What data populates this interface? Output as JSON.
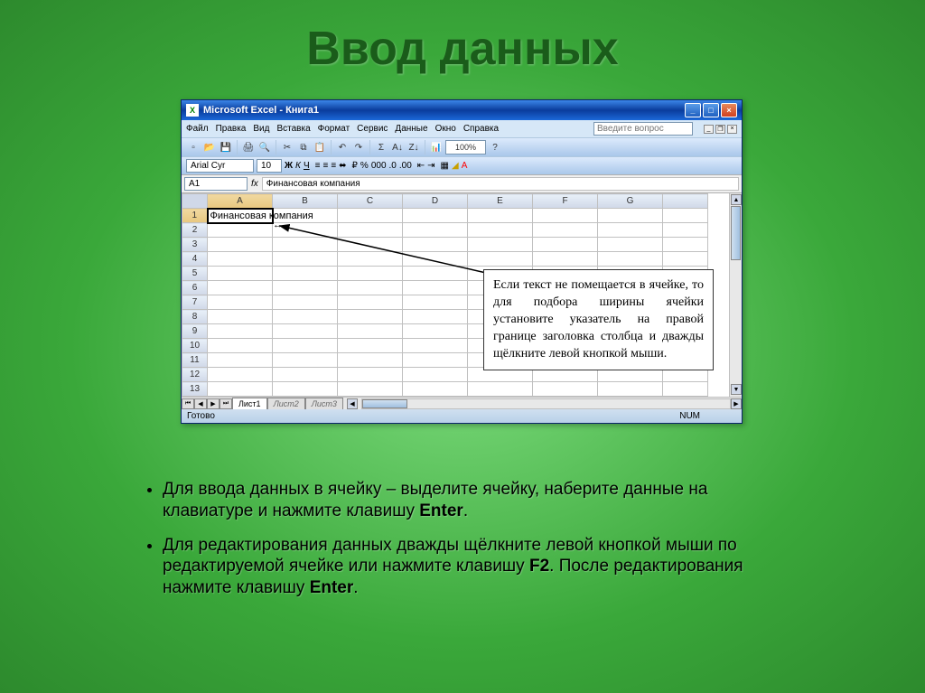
{
  "slide": {
    "title": "Ввод данных"
  },
  "excel": {
    "title": "Microsoft Excel - Книга1",
    "menu": {
      "file": "Файл",
      "edit": "Правка",
      "view": "Вид",
      "insert": "Вставка",
      "format": "Формат",
      "tools": "Сервис",
      "data": "Данные",
      "window": "Окно",
      "help": "Справка"
    },
    "help_placeholder": "Введите вопрос",
    "font_name": "Arial Cyr",
    "font_size": "10",
    "name_box": "A1",
    "fx": "fx",
    "formula": "Финансовая компания",
    "columns": [
      "A",
      "B",
      "C",
      "D",
      "E",
      "F",
      "G"
    ],
    "rows": [
      "1",
      "2",
      "3",
      "4",
      "5",
      "6",
      "7",
      "8",
      "9",
      "10",
      "11",
      "12",
      "13"
    ],
    "cell_a1": "Финансовая компания",
    "sheets": {
      "s1": "Лист1",
      "s2": "Лист2",
      "s3": "Лист3"
    },
    "status": "Готово",
    "num": "NUM"
  },
  "tooltip": "Если текст не помещается в ячейке, то для подбора ширины ячейки установите указатель на правой границе заголовка столбца и дважды щёлкните левой кнопкой мыши.",
  "bullets": {
    "b1_pre": "Для ввода данных в ячейку – выделите ячейку, наберите данные на клавиатуре и нажмите клавишу ",
    "b1_key": "Enter",
    "b2_pre": "Для редактирования данных дважды щёлкните левой кнопкой мыши по редактируемой ячейке или нажмите клавишу ",
    "b2_key1": "F2",
    "b2_mid": ". После редактирования нажмите клавишу ",
    "b2_key2": "Enter"
  }
}
